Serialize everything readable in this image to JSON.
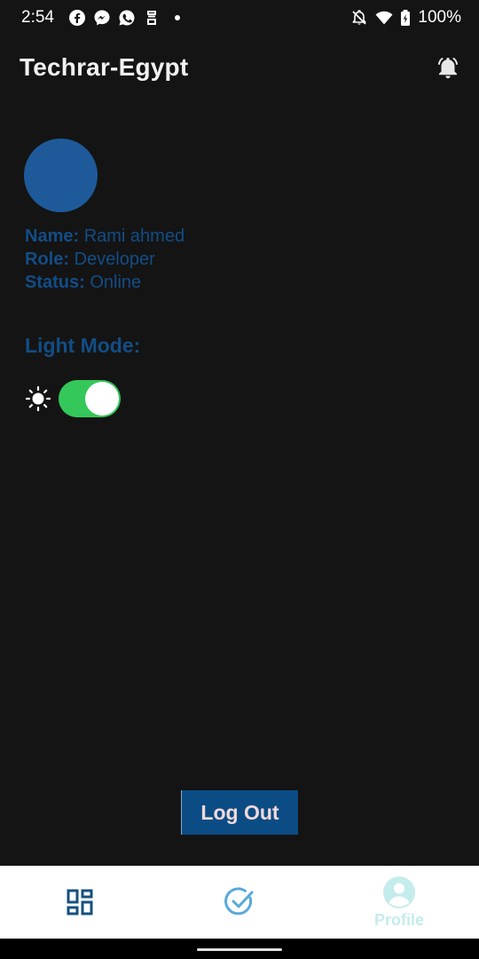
{
  "status_bar": {
    "time": "2:54",
    "battery": "100%",
    "left_icons": [
      "facebook-icon",
      "messenger-icon",
      "whatsapp-icon",
      "app-icon",
      "dot"
    ],
    "right_icons": [
      "notifications-off-icon",
      "wifi-icon",
      "battery-charging-icon"
    ]
  },
  "app_bar": {
    "title": "Techrar-Egypt",
    "action_icon": "bell-icon"
  },
  "profile": {
    "name_label": "Name:",
    "name_value": "Rami ahmed",
    "role_label": "Role:",
    "role_value": "Developer",
    "status_label": "Status:",
    "status_value": "Online"
  },
  "mode": {
    "title": "Light Mode:",
    "toggle_on": true,
    "light_icon": "sun-icon",
    "dark_icon": "moon-icon"
  },
  "logout": {
    "label": "Log Out"
  },
  "bottom_nav": {
    "items": [
      {
        "icon": "dashboard-icon",
        "label": ""
      },
      {
        "icon": "check-circle-icon",
        "label": ""
      },
      {
        "icon": "profile-icon",
        "label": "Profile"
      }
    ]
  },
  "colors": {
    "background": "#141414",
    "primary": "#124d87",
    "avatar": "#1e5a99",
    "toggle": "#34c759",
    "nav_active": "#c5ecec",
    "nav_icon": "#16507f"
  }
}
